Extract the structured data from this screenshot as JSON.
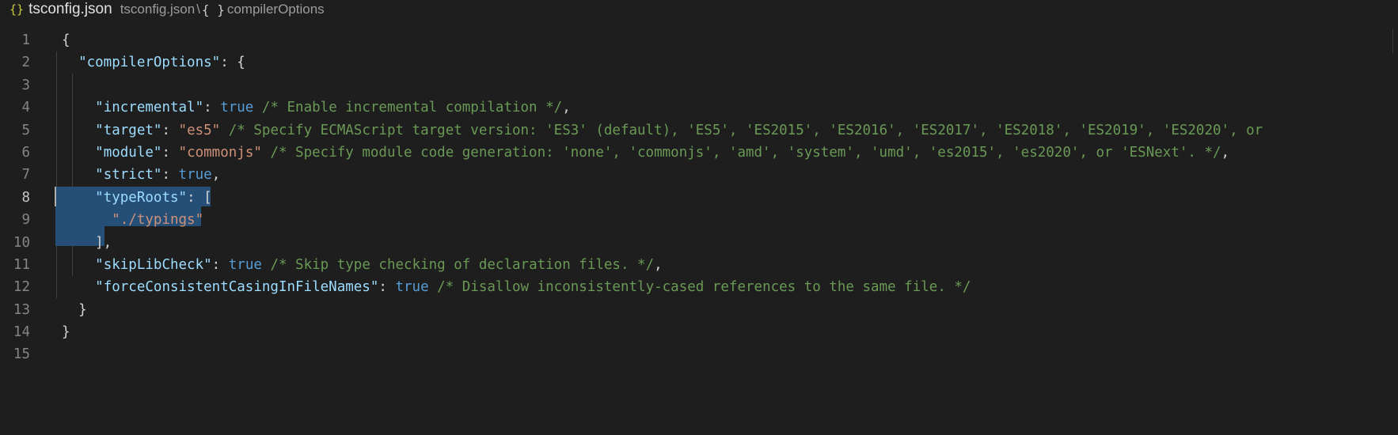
{
  "breadcrumb": {
    "file_icon": "{}",
    "file_name": "tsconfig.json",
    "path": "tsconfig.json",
    "separator": "\\",
    "object_icon": "{ }",
    "segment": "compilerOptions"
  },
  "colors": {
    "background": "#1e1e1e",
    "key": "#9cdcfe",
    "string": "#ce9178",
    "boolean": "#569cd6",
    "comment": "#6a9955",
    "selection": "#264f78"
  },
  "editor": {
    "active_line": 8,
    "lines": [
      {
        "n": "1",
        "tokens": [
          [
            "p",
            "{"
          ]
        ]
      },
      {
        "n": "2",
        "tokens": [
          [
            "p",
            "  "
          ],
          [
            "k",
            "\"compilerOptions\""
          ],
          [
            "p",
            ": {"
          ]
        ]
      },
      {
        "n": "3",
        "tokens": []
      },
      {
        "n": "4",
        "tokens": [
          [
            "p",
            "    "
          ],
          [
            "k",
            "\"incremental\""
          ],
          [
            "p",
            ": "
          ],
          [
            "b",
            "true"
          ],
          [
            "p",
            " "
          ],
          [
            "c",
            "/* Enable incremental compilation */"
          ],
          [
            "p",
            ","
          ]
        ]
      },
      {
        "n": "5",
        "tokens": [
          [
            "p",
            "    "
          ],
          [
            "k",
            "\"target\""
          ],
          [
            "p",
            ": "
          ],
          [
            "s",
            "\"es5\""
          ],
          [
            "p",
            " "
          ],
          [
            "c",
            "/* Specify ECMAScript target version: 'ES3' (default), 'ES5', 'ES2015', 'ES2016', 'ES2017', 'ES2018', 'ES2019', 'ES2020', or"
          ]
        ]
      },
      {
        "n": "6",
        "tokens": [
          [
            "p",
            "    "
          ],
          [
            "k",
            "\"module\""
          ],
          [
            "p",
            ": "
          ],
          [
            "s",
            "\"commonjs\""
          ],
          [
            "p",
            " "
          ],
          [
            "c",
            "/* Specify module code generation: 'none', 'commonjs', 'amd', 'system', 'umd', 'es2015', 'es2020', or 'ESNext'. */"
          ],
          [
            "p",
            ","
          ]
        ]
      },
      {
        "n": "7",
        "tokens": [
          [
            "p",
            "    "
          ],
          [
            "k",
            "\"strict\""
          ],
          [
            "p",
            ": "
          ],
          [
            "b",
            "true"
          ],
          [
            "p",
            ","
          ]
        ]
      },
      {
        "n": "8",
        "tokens": [
          [
            "p",
            "    "
          ],
          [
            "k",
            "\"typeRoots\""
          ],
          [
            "p",
            ": ["
          ]
        ]
      },
      {
        "n": "9",
        "tokens": [
          [
            "p",
            "      "
          ],
          [
            "s",
            "\"./typings\""
          ]
        ]
      },
      {
        "n": "10",
        "tokens": [
          [
            "p",
            "    ],"
          ]
        ]
      },
      {
        "n": "11",
        "tokens": [
          [
            "p",
            "    "
          ],
          [
            "k",
            "\"skipLibCheck\""
          ],
          [
            "p",
            ": "
          ],
          [
            "b",
            "true"
          ],
          [
            "p",
            " "
          ],
          [
            "c",
            "/* Skip type checking of declaration files. */"
          ],
          [
            "p",
            ","
          ]
        ]
      },
      {
        "n": "12",
        "tokens": [
          [
            "p",
            "    "
          ],
          [
            "k",
            "\"forceConsistentCasingInFileNames\""
          ],
          [
            "p",
            ": "
          ],
          [
            "b",
            "true"
          ],
          [
            "p",
            " "
          ],
          [
            "c",
            "/* Disallow inconsistently-cased references to the same file. */"
          ]
        ]
      },
      {
        "n": "13",
        "tokens": [
          [
            "p",
            "  }"
          ]
        ]
      },
      {
        "n": "14",
        "tokens": [
          [
            "p",
            "}"
          ]
        ]
      },
      {
        "n": "15",
        "tokens": []
      }
    ]
  }
}
